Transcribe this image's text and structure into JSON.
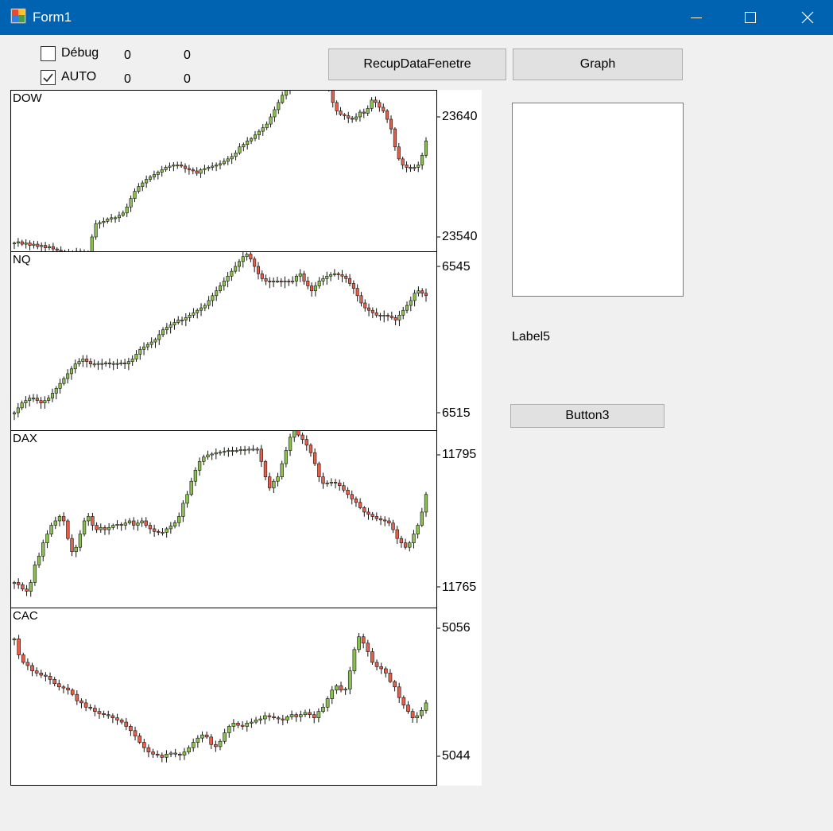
{
  "window": {
    "title": "Form1"
  },
  "controls": {
    "debug_label": "Débug",
    "debug_checked": false,
    "auto_label": "AUTO",
    "auto_checked": true,
    "val_r1_a": "0",
    "val_r1_b": "0",
    "val_r2_a": "0",
    "val_r2_b": "0"
  },
  "buttons": {
    "recup": "RecupDataFenetre",
    "graph": "Graph",
    "button3": "Button3"
  },
  "label5": "Label5",
  "colors": {
    "titlebar": "#0063b1",
    "up": "#8cc152",
    "down": "#e8604c"
  },
  "chart_data": [
    {
      "type": "candlestick",
      "title": "DOW",
      "yticks": [
        "23640",
        "23540"
      ],
      "closes": [
        23535,
        23536,
        23534,
        23535,
        23533,
        23534,
        23532,
        23533,
        23531,
        23532,
        23530,
        23529,
        23528,
        23526,
        23527,
        23527,
        23528,
        23527,
        23526,
        23525,
        23540,
        23551,
        23552,
        23553,
        23555,
        23556,
        23556,
        23558,
        23560,
        23565,
        23572,
        23578,
        23582,
        23585,
        23588,
        23590,
        23592,
        23594,
        23596,
        23598,
        23599,
        23600,
        23600,
        23599,
        23597,
        23596,
        23595,
        23593,
        23596,
        23597,
        23598,
        23599,
        23600,
        23601,
        23603,
        23605,
        23607,
        23610,
        23615,
        23617,
        23620,
        23622,
        23625,
        23628,
        23631,
        23634,
        23640,
        23646,
        23652,
        23658,
        23663,
        23667,
        23672,
        23678,
        23684,
        23690,
        23694,
        23698,
        23699,
        23690,
        23678,
        23664,
        23652,
        23645,
        23642,
        23641,
        23639,
        23638,
        23640,
        23644,
        23643,
        23647,
        23654,
        23652,
        23648,
        23645,
        23638,
        23630,
        23615,
        23605,
        23600,
        23598,
        23597,
        23598,
        23600,
        23608,
        23620
      ]
    },
    {
      "type": "candlestick",
      "title": "NQ",
      "yticks": [
        "6545",
        "6515"
      ],
      "closes": [
        6515,
        6516,
        6517,
        6517.5,
        6518,
        6518,
        6517.5,
        6517,
        6517.5,
        6518,
        6519,
        6520,
        6521,
        6522,
        6523,
        6524,
        6525,
        6525.5,
        6526,
        6525.5,
        6525,
        6525,
        6525.1,
        6525,
        6525.2,
        6525,
        6525.1,
        6525,
        6525.2,
        6525,
        6525.5,
        6526,
        6527,
        6528,
        6528.5,
        6529,
        6529.5,
        6530,
        6531,
        6532,
        6532.5,
        6533,
        6533.5,
        6534,
        6534,
        6534.5,
        6535,
        6535.5,
        6536,
        6536.5,
        6537,
        6538,
        6539,
        6540,
        6541,
        6542,
        6543,
        6544,
        6545,
        6546,
        6547,
        6547.5,
        6546.5,
        6545,
        6543.5,
        6542.5,
        6542,
        6541.8,
        6542,
        6542,
        6541.8,
        6542,
        6541.9,
        6542,
        6543,
        6543.5,
        6542,
        6541,
        6540,
        6541,
        6542,
        6542.5,
        6543,
        6543.3,
        6543.5,
        6543.3,
        6543,
        6542.5,
        6541.5,
        6540.5,
        6539,
        6537.5,
        6536.5,
        6536,
        6535.5,
        6535,
        6534.8,
        6535,
        6534.8,
        6534.5,
        6534,
        6535,
        6536,
        6537,
        6538,
        6539.5,
        6540,
        6539.5,
        6539
      ]
    },
    {
      "type": "candlestick",
      "title": "DAX",
      "yticks": [
        "11795",
        "11765"
      ],
      "closes": [
        11766,
        11765.5,
        11764.5,
        11764,
        11766,
        11770,
        11772,
        11775,
        11777,
        11779,
        11780,
        11781,
        11780,
        11776,
        11773,
        11774,
        11777,
        11780,
        11781,
        11779,
        11778,
        11778.5,
        11778,
        11778.5,
        11779,
        11779.2,
        11779,
        11779.5,
        11780,
        11779,
        11779.5,
        11780,
        11779,
        11778.2,
        11777.6,
        11777.4,
        11777.4,
        11778.2,
        11778.8,
        11779.6,
        11781,
        11784,
        11786,
        11789,
        11791.5,
        11793.5,
        11794.5,
        11795,
        11795.2,
        11795.5,
        11795.6,
        11795.8,
        11796,
        11795.9,
        11796,
        11796.2,
        11796.2,
        11796.3,
        11796.3,
        11796.3,
        11793.5,
        11790,
        11787.5,
        11789,
        11790,
        11793,
        11796,
        11799,
        11800.5,
        11799.5,
        11798.5,
        11797.2,
        11795.5,
        11793,
        11790,
        11788.5,
        11788.6,
        11788.8,
        11788.6,
        11788,
        11787,
        11786,
        11785,
        11784.2,
        11783,
        11782,
        11781.5,
        11781,
        11780.5,
        11780.2,
        11780,
        11779.5,
        11778,
        11776,
        11775,
        11774,
        11775,
        11777,
        11779,
        11782,
        11786
      ]
    },
    {
      "type": "candlestick",
      "title": "CAC",
      "yticks": [
        "5056",
        "5044"
      ],
      "closes": [
        5055,
        5053.5,
        5052.8,
        5052.5,
        5052,
        5051.8,
        5051.6,
        5051.5,
        5051.2,
        5050.8,
        5050.5,
        5050.4,
        5050.2,
        5049.8,
        5049.2,
        5049,
        5048.6,
        5048.5,
        5048.2,
        5048,
        5047.9,
        5047.8,
        5047.6,
        5047.4,
        5047.2,
        5046.8,
        5046.4,
        5045.9,
        5045.3,
        5044.8,
        5044.4,
        5044.2,
        5044.1,
        5043.9,
        5044.2,
        5044.3,
        5044.2,
        5044.1,
        5044.4,
        5044.8,
        5045.3,
        5045.7,
        5046,
        5045.8,
        5045.1,
        5044.9,
        5045.4,
        5046.2,
        5046.8,
        5047.1,
        5046.9,
        5046.8,
        5047.1,
        5047.2,
        5047.4,
        5047.5,
        5047.8,
        5047.7,
        5047.6,
        5047.5,
        5047.4,
        5047.7,
        5047.9,
        5047.7,
        5047.9,
        5048.1,
        5047.9,
        5047.6,
        5048.2,
        5048.6,
        5049.4,
        5050.2,
        5050.6,
        5050.2,
        5050.3,
        5052,
        5054,
        5055.2,
        5054.6,
        5053.8,
        5052.8,
        5052.4,
        5052.2,
        5051.8,
        5051,
        5050.5,
        5049.5,
        5048.8,
        5048.2,
        5047.6,
        5047.8,
        5048.3,
        5049
      ]
    }
  ]
}
